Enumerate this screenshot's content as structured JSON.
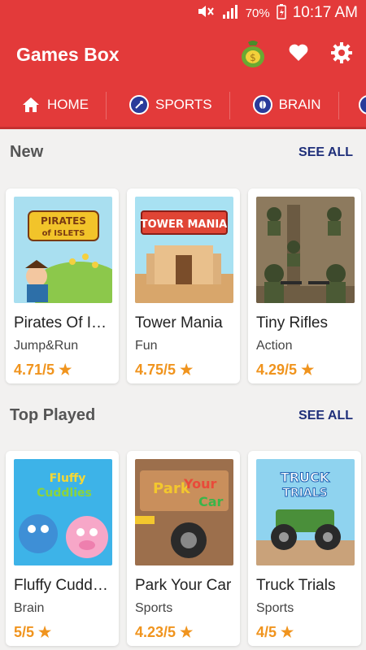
{
  "status": {
    "battery": "70%",
    "time": "10:17 AM"
  },
  "app": {
    "title": "Games Box"
  },
  "tabs": [
    {
      "label": "HOME"
    },
    {
      "label": "SPORTS"
    },
    {
      "label": "BRAIN"
    }
  ],
  "sections": [
    {
      "title": "New",
      "see_all": "SEE ALL",
      "games": [
        {
          "name": "Pirates Of Isl…",
          "category": "Jump&Run",
          "rating": "4.71/5",
          "thumb_text": "PIRATES of ISLETS"
        },
        {
          "name": "Tower Mania",
          "category": "Fun",
          "rating": "4.75/5",
          "thumb_text": "TOWER MANIA"
        },
        {
          "name": "Tiny Rifles",
          "category": "Action",
          "rating": "4.29/5",
          "thumb_text": ""
        }
      ]
    },
    {
      "title": "Top Played",
      "see_all": "SEE ALL",
      "games": [
        {
          "name": "Fluffy Cuddli…",
          "category": "Brain",
          "rating": "5/5",
          "thumb_text": "Fluffy Cuddlies"
        },
        {
          "name": "Park Your Car",
          "category": "Sports",
          "rating": "4.23/5",
          "thumb_text": "Park Your Car"
        },
        {
          "name": "Truck Trials",
          "category": "Sports",
          "rating": "4/5",
          "thumb_text": "TRUCK TRIALS"
        }
      ]
    }
  ],
  "colors": {
    "primary": "#e33a3a",
    "accent": "#1f2f7a",
    "rating": "#f0941e"
  }
}
